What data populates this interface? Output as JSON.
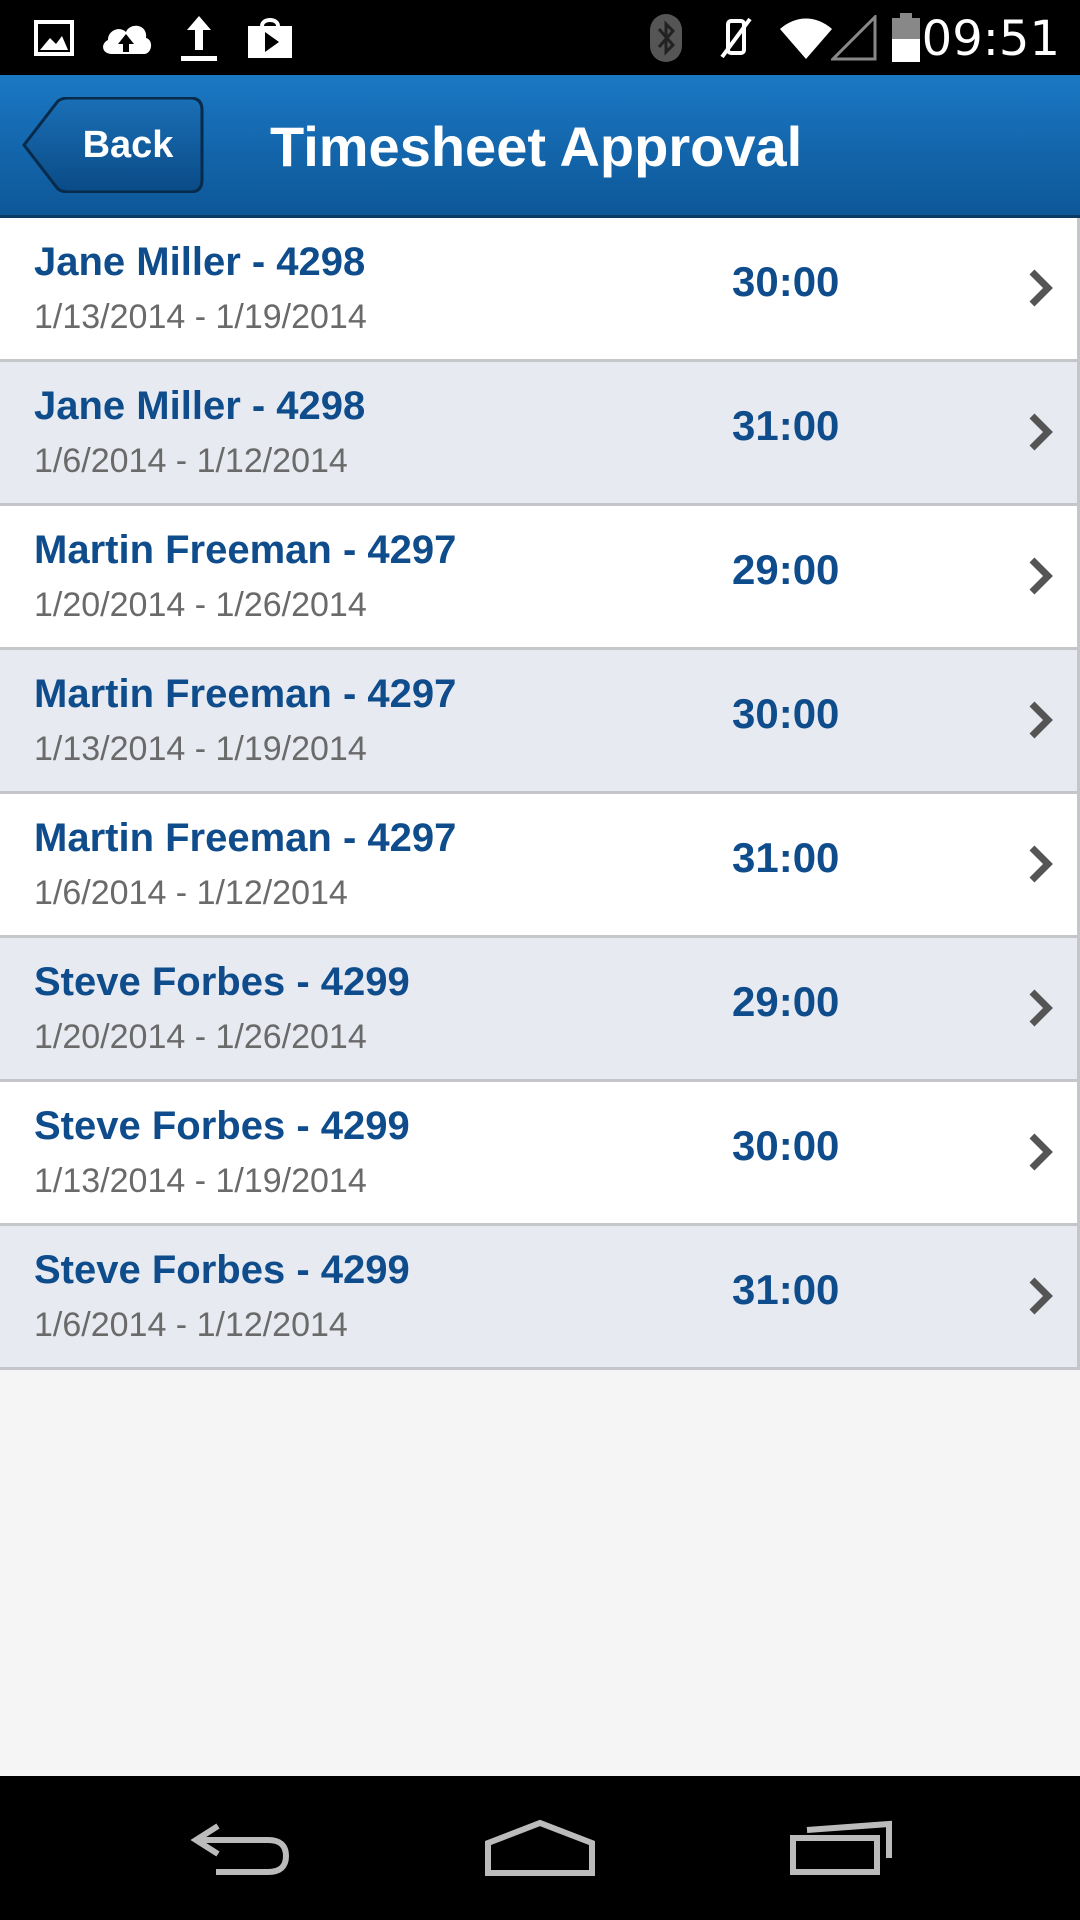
{
  "status_bar": {
    "time": "09:51",
    "left_icons": [
      "gallery-icon",
      "cloud-upload-icon",
      "upload-icon",
      "play-store-icon"
    ],
    "right_icons": [
      "bluetooth-icon",
      "mute-icon",
      "wifi-icon",
      "signal-icon",
      "battery-icon"
    ]
  },
  "header": {
    "back_label": "Back",
    "title": "Timesheet Approval",
    "color": "#1467ad"
  },
  "timesheets": [
    {
      "name": "Jane Miller - 4298",
      "dates": "1/13/2014 - 1/19/2014",
      "hours": "30:00"
    },
    {
      "name": "Jane Miller - 4298",
      "dates": "1/6/2014 - 1/12/2014",
      "hours": "31:00"
    },
    {
      "name": "Martin Freeman - 4297",
      "dates": "1/20/2014 - 1/26/2014",
      "hours": "29:00"
    },
    {
      "name": "Martin Freeman - 4297",
      "dates": "1/13/2014 - 1/19/2014",
      "hours": "30:00"
    },
    {
      "name": "Martin Freeman - 4297",
      "dates": "1/6/2014 - 1/12/2014",
      "hours": "31:00"
    },
    {
      "name": "Steve Forbes - 4299",
      "dates": "1/20/2014 - 1/26/2014",
      "hours": "29:00"
    },
    {
      "name": "Steve Forbes - 4299",
      "dates": "1/13/2014 - 1/19/2014",
      "hours": "30:00"
    },
    {
      "name": "Steve Forbes - 4299",
      "dates": "1/6/2014 - 1/12/2014",
      "hours": "31:00"
    }
  ],
  "nav_bar": {
    "buttons": [
      "back-nav-icon",
      "home-nav-icon",
      "recent-apps-icon"
    ]
  }
}
